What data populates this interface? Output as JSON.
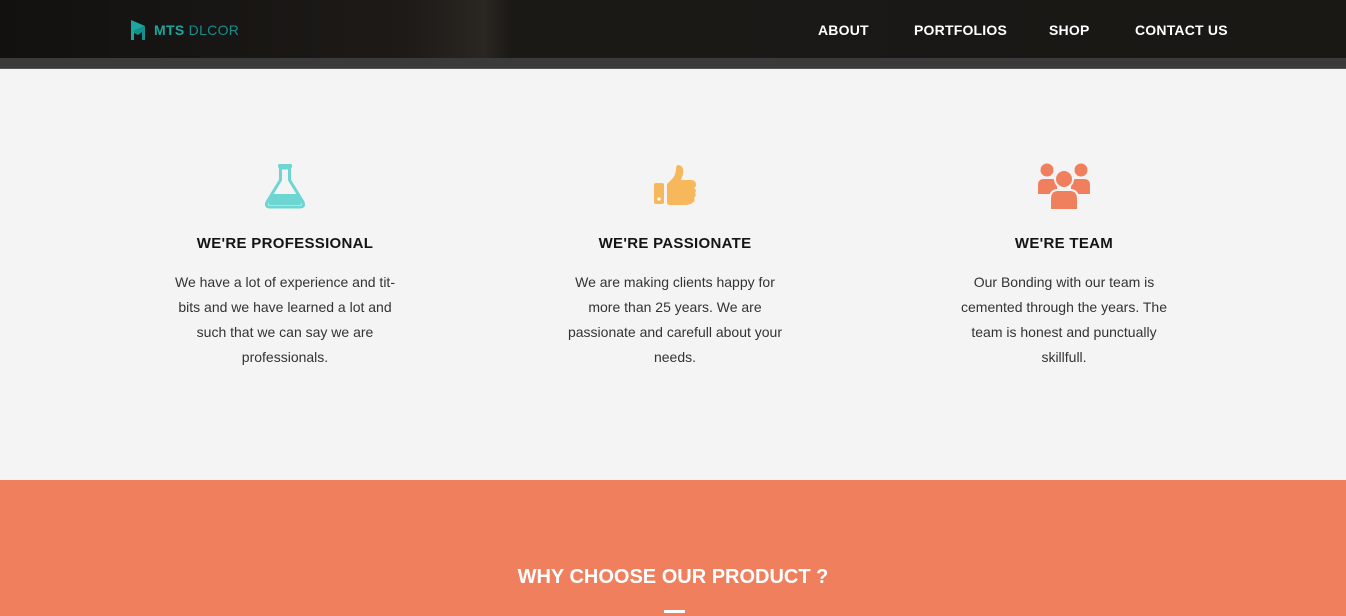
{
  "brand": {
    "strong": "MTS",
    "light": "DLCOR"
  },
  "nav": {
    "about": "ABOUT",
    "portfolios": "PORTFOLIOS",
    "shop": "SHOP",
    "contact": "CONTACT US"
  },
  "features": [
    {
      "icon": "flask-icon",
      "icon_color": "#6dd6d2",
      "title": "WE'RE PROFESSIONAL",
      "text": "We have a lot of experience and tit-bits and we have learned a lot and such that we can say we are professionals."
    },
    {
      "icon": "thumbs-up-icon",
      "icon_color": "#f7b85c",
      "title": "WE'RE PASSIONATE",
      "text": "We are making clients happy for more than 25 years. We are passionate and carefull about your needs."
    },
    {
      "icon": "team-icon",
      "icon_color": "#f07f5e",
      "title": "WE'RE TEAM",
      "text": "Our Bonding with our team is cemented through the years. The team is honest and punctually skillfull."
    }
  ],
  "why": {
    "title": "WHY CHOOSE OUR PRODUCT ?"
  },
  "colors": {
    "accent": "#f07f5e",
    "brand": "#1aa7a0",
    "navbar": "#1a1815"
  }
}
